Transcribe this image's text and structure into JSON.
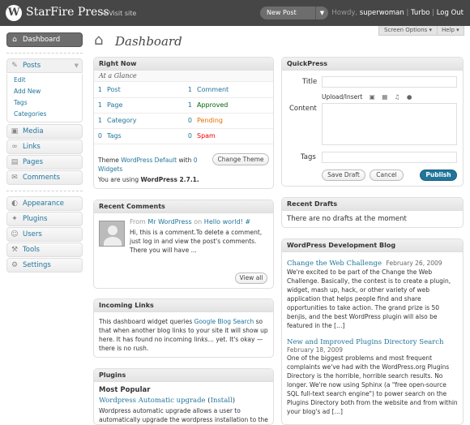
{
  "header": {
    "site_title": "StarFire Press",
    "visit_site": "← Visit site",
    "new_post": "New Post",
    "howdy": "Howdy,",
    "username": "superwoman",
    "turbo": "Turbo",
    "separator": "|",
    "logout": "Log Out",
    "screen_options": "Screen Options ▾",
    "help": "Help ▾"
  },
  "sidebar": {
    "dashboard": "Dashboard",
    "posts": "Posts",
    "posts_sub": [
      "Edit",
      "Add New",
      "Tags",
      "Categories"
    ],
    "items_a": [
      "Media",
      "Links",
      "Pages",
      "Comments"
    ],
    "items_b": [
      "Appearance",
      "Plugins",
      "Users",
      "Tools",
      "Settings"
    ]
  },
  "page_title": "Dashboard",
  "right_now": {
    "title": "Right Now",
    "subtitle": "At a Glance",
    "rows": [
      {
        "ln": "1",
        "ll": "Post",
        "rn": "1",
        "rl": "Comment",
        "rc": "#21759b"
      },
      {
        "ln": "1",
        "ll": "Page",
        "rn": "1",
        "rl": "Approved",
        "rc": "#006505"
      },
      {
        "ln": "1",
        "ll": "Category",
        "rn": "0",
        "rl": "Pending",
        "rc": "#e66f00"
      },
      {
        "ln": "0",
        "ll": "Tags",
        "rn": "0",
        "rl": "Spam",
        "rc": "#e00"
      }
    ],
    "theme_prefix": "Theme",
    "theme_name": "WordPress Default",
    "theme_mid": "with",
    "widgets_link": "0 Widgets",
    "change_theme": "Change Theme",
    "version_prefix": "You are using",
    "version": "WordPress 2.7.1."
  },
  "quickpress": {
    "title": "QuickPress",
    "title_label": "Title",
    "upload_insert": "Upload/Insert",
    "content_label": "Content",
    "tags_label": "Tags",
    "save_draft": "Save Draft",
    "cancel": "Cancel",
    "publish": "Publish"
  },
  "recent_comments": {
    "title": "Recent Comments",
    "from": "From",
    "author": "Mr WordPress",
    "on": "on",
    "post": "Hello world!",
    "hash": "#",
    "excerpt": "Hi, this is a comment.To delete a comment, just log in and view the post's comments. There you will have ...",
    "view_all": "View all"
  },
  "recent_drafts": {
    "title": "Recent Drafts",
    "empty": "There are no drafts at the moment"
  },
  "incoming_links": {
    "title": "Incoming Links",
    "text_pre": "This dashboard widget queries",
    "link": "Google Blog Search",
    "text_post": "so that when another blog links to your site it will show up here. It has found no incoming links… yet. It's okay — there is no rush."
  },
  "dev_blog": {
    "title": "WordPress Development Blog",
    "posts": [
      {
        "title": "Change the Web Challenge",
        "date": "February 26, 2009",
        "excerpt": "We're excited to be part of the Change the Web Challenge. Basically, the contest is to create a plugin, widget, mash up, hack, or other variety of web application that helps people find and share opportunities to take action. The grand prize is 50 benjis, and the best WordPress plugin will also be featured in the […]"
      },
      {
        "title": "New and Improved Plugins Directory Search",
        "date": "February 18, 2009",
        "excerpt": "One of the biggest problems and most frequent complaints we've had with the WordPress.org Plugins Directory is the horrible, horrible search results. No longer. We're now using Sphinx (a \"free open-source SQL full-text search engine\") to power search on the Plugins Directory both from the website and from within your blog's ad […]"
      }
    ]
  },
  "plugins": {
    "title": "Plugins",
    "most_popular": "Most Popular",
    "plugin_name": "Wordpress Automatic upgrade",
    "install": "Install",
    "paren_open": "(",
    "paren_close": ")",
    "description": "Wordpress automatic upgrade allows a user to automatically upgrade the wordpress installation to the"
  }
}
